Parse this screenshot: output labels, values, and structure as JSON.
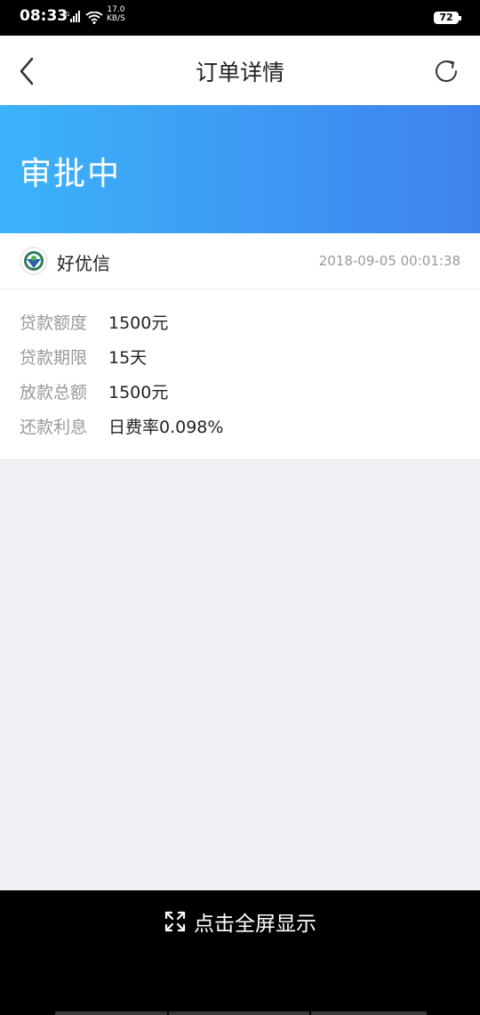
{
  "status_bar": {
    "time": "08:33",
    "network": "4G",
    "speed_value": "17.0",
    "speed_unit": "KB/S",
    "battery": "72"
  },
  "nav": {
    "title": "订单详情",
    "back_icon": "chevron-left-icon",
    "refresh_icon": "refresh-icon"
  },
  "banner": {
    "status_text": "审批中",
    "gradient_start": "#3cb3fa",
    "gradient_end": "#3f82ee"
  },
  "order": {
    "lender_name": "好优信",
    "logo_icon": "lender-logo-icon",
    "datetime": "2018-09-05 00:01:38",
    "details": [
      {
        "label": "贷款额度",
        "value": "1500元"
      },
      {
        "label": "贷款期限",
        "value": "15天"
      },
      {
        "label": "放款总额",
        "value": "1500元"
      },
      {
        "label": "还款利息",
        "value": "日费率0.098%"
      }
    ]
  },
  "footer": {
    "fullscreen_label": "点击全屏显示",
    "fullscreen_icon": "expand-icon"
  }
}
